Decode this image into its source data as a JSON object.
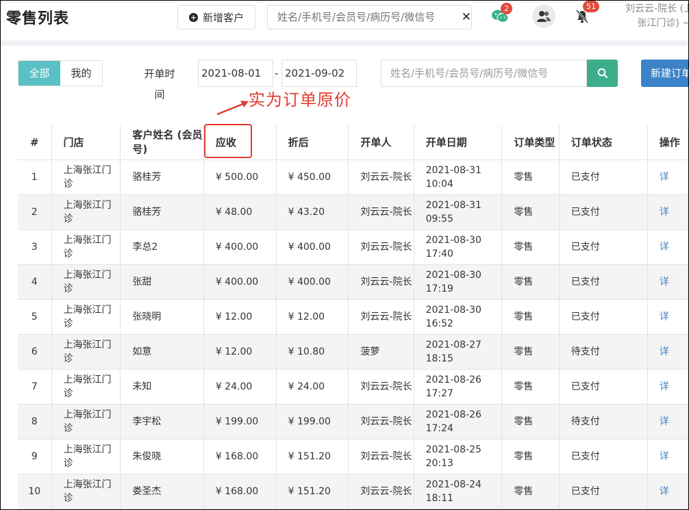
{
  "header": {
    "title": "零售列表",
    "add_customer_label": "新增客户",
    "search_placeholder": "姓名/手机号/会员号/病历号/微信号",
    "wechat_badge": "2",
    "bell_badge": "51",
    "user_line1": "刘云云-院长 (上海",
    "user_line2": "张江门诊) ~"
  },
  "filters": {
    "tab_all": "全部",
    "tab_mine": "我的",
    "date_label": "开单时间",
    "date_start": "2021-08-01",
    "date_sep": "-",
    "date_end": "2021-09-02",
    "search_placeholder": "姓名/手机号/会员号/病历号/微信号",
    "new_order_label": "新建订单"
  },
  "annotation": {
    "text": "实为订单原价",
    "color": "#e03c31"
  },
  "table": {
    "columns": [
      "#",
      "门店",
      "客户姓名 (会员号)",
      "应收",
      "折后",
      "开单人",
      "开单日期",
      "订单类型",
      "订单状态",
      "操作"
    ],
    "rows": [
      {
        "no": "1",
        "store": "上海张江门诊",
        "customer": "骆桂芳",
        "receivable": "¥ 500.00",
        "discounted": "¥ 450.00",
        "creator": "刘云云-院长",
        "date": "2021-08-31 10:04",
        "type": "零售",
        "status": "已支付",
        "action": "详"
      },
      {
        "no": "2",
        "store": "上海张江门诊",
        "customer": "骆桂芳",
        "receivable": "¥ 48.00",
        "discounted": "¥ 43.20",
        "creator": "刘云云-院长",
        "date": "2021-08-31 09:55",
        "type": "零售",
        "status": "已支付",
        "action": "详"
      },
      {
        "no": "3",
        "store": "上海张江门诊",
        "customer": "李总2",
        "receivable": "¥ 400.00",
        "discounted": "¥ 400.00",
        "creator": "刘云云-院长",
        "date": "2021-08-30 17:40",
        "type": "零售",
        "status": "已支付",
        "action": "详"
      },
      {
        "no": "4",
        "store": "上海张江门诊",
        "customer": "张甜",
        "receivable": "¥ 400.00",
        "discounted": "¥ 400.00",
        "creator": "刘云云-院长",
        "date": "2021-08-30 17:19",
        "type": "零售",
        "status": "已支付",
        "action": "详"
      },
      {
        "no": "5",
        "store": "上海张江门诊",
        "customer": "张晓明",
        "receivable": "¥ 12.00",
        "discounted": "¥ 12.00",
        "creator": "刘云云-院长",
        "date": "2021-08-30 16:52",
        "type": "零售",
        "status": "已支付",
        "action": "详"
      },
      {
        "no": "6",
        "store": "上海张江门诊",
        "customer": "如意",
        "receivable": "¥ 12.00",
        "discounted": "¥ 10.80",
        "creator": "菠萝",
        "date": "2021-08-27 18:15",
        "type": "零售",
        "status": "待支付",
        "action": "详"
      },
      {
        "no": "7",
        "store": "上海张江门诊",
        "customer": "未知",
        "receivable": "¥ 24.00",
        "discounted": "¥ 24.00",
        "creator": "刘云云-院长",
        "date": "2021-08-26 17:27",
        "type": "零售",
        "status": "已支付",
        "action": "详"
      },
      {
        "no": "8",
        "store": "上海张江门诊",
        "customer": "李宇松",
        "receivable": "¥ 199.00",
        "discounted": "¥ 199.00",
        "creator": "刘云云-院长",
        "date": "2021-08-26 17:24",
        "type": "零售",
        "status": "待支付",
        "action": "详"
      },
      {
        "no": "9",
        "store": "上海张江门诊",
        "customer": "朱俊晓",
        "receivable": "¥ 168.00",
        "discounted": "¥ 151.20",
        "creator": "刘云云-院长",
        "date": "2021-08-25 20:13",
        "type": "零售",
        "status": "已支付",
        "action": "详"
      },
      {
        "no": "10",
        "store": "上海张江门诊",
        "customer": "娄圣杰",
        "receivable": "¥ 168.00",
        "discounted": "¥ 151.20",
        "creator": "刘云云-院长",
        "date": "2021-08-24 18:11",
        "type": "零售",
        "status": "已支付",
        "action": "详"
      }
    ]
  },
  "icons": {
    "wechat": "wechat-icon",
    "group": "users-icon",
    "bell": "bell-muted-icon",
    "plus": "plus-circle-icon",
    "close": "close-icon",
    "search": "search-icon"
  }
}
